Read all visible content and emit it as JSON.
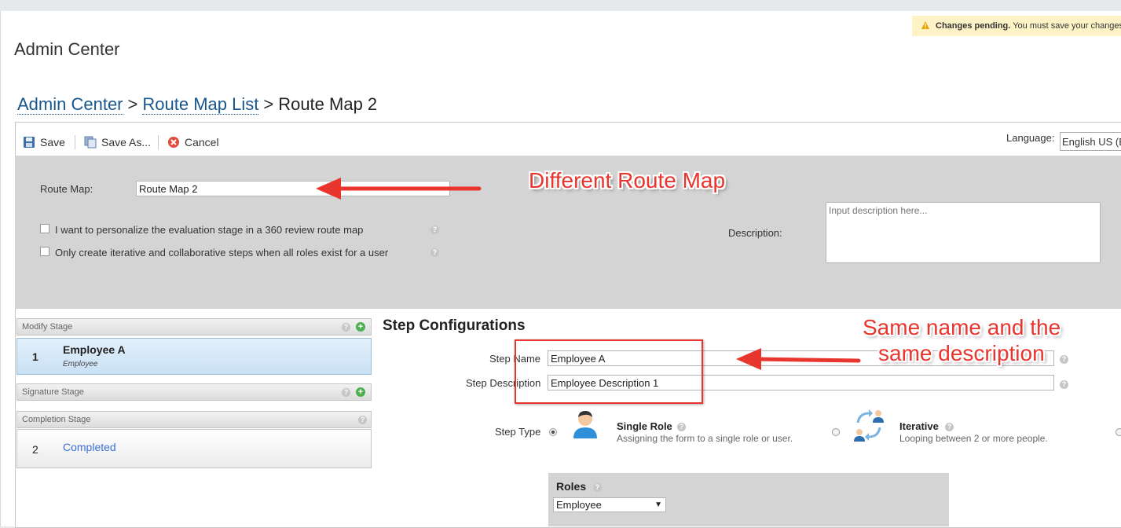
{
  "app": {
    "title": "Admin Center"
  },
  "notice": {
    "strong": "Changes pending.",
    "text": " You must save your changes"
  },
  "breadcrumb": {
    "items": [
      "Admin Center",
      "Route Map List"
    ],
    "separator": ">",
    "current": "Route Map 2"
  },
  "toolbar": {
    "save": "Save",
    "save_as": "Save As...",
    "cancel": "Cancel",
    "language_label": "Language:",
    "language_value": "English US (E"
  },
  "form": {
    "route_map_label": "Route Map:",
    "route_map_value": "Route Map 2",
    "checkbox1": "I want to personalize the evaluation stage in a 360 review route map",
    "checkbox2": "Only create iterative and collaborative steps when all roles exist for a user",
    "description_label": "Description:",
    "description_placeholder": "Input description here..."
  },
  "stages": {
    "modify": {
      "title": "Modify Stage",
      "step_num": "1",
      "step_name": "Employee A",
      "step_role": "Employee"
    },
    "signature": {
      "title": "Signature Stage"
    },
    "completion": {
      "title": "Completion Stage",
      "step_num": "2",
      "step_name": "Completed"
    }
  },
  "step_config": {
    "title": "Step Configurations",
    "step_name_label": "Step Name",
    "step_name_value": "Employee A",
    "step_desc_label": "Step Description",
    "step_desc_value": "Employee Description 1",
    "step_type_label": "Step Type",
    "single_role_title": "Single Role",
    "single_role_desc": "Assigning the form to a single role or user.",
    "iterative_title": "Iterative",
    "iterative_desc": "Looping between 2 or more people.",
    "roles_label": "Roles",
    "roles_value": "Employee"
  },
  "annotations": {
    "route_map": "Different Route Map",
    "same_line1": "Same name and the",
    "same_line2": "same description"
  },
  "colors": {
    "annotation": "#e8352e",
    "link": "#19578f",
    "selected_step": "#c9e1f5",
    "completed_link": "#3a6fd8"
  }
}
